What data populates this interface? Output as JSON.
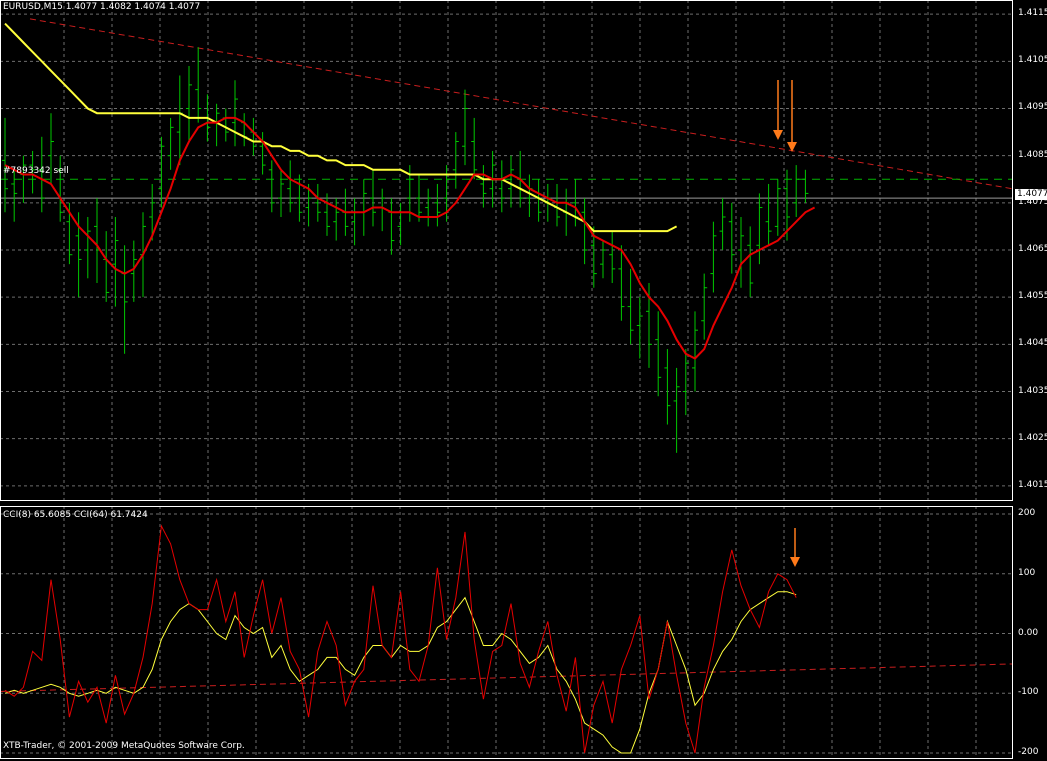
{
  "colors": {
    "background": "#000000",
    "grid": "#c8c8c8",
    "bars": "#00c800",
    "ma_fast": "#e60000",
    "ma_slow": "#ffff3c",
    "trendline": "#c81e1e",
    "order_line": "#00b400",
    "arrow": "#ff7a1a",
    "cci_fast": "#e60000",
    "cci_slow": "#ffff3c",
    "text": "#ffffff"
  },
  "price_panel": {
    "header": "EURUSD,M15  1.4077 1.4082 1.4074 1.4077",
    "order_label": "#7893342 sell",
    "current_price": "1.4077",
    "price_labels": [
      "1.4115",
      "1.4105",
      "1.4095",
      "1.4085",
      "1.4075",
      "1.4065",
      "1.4055",
      "1.4045",
      "1.4035",
      "1.4025",
      "1.4015"
    ],
    "ylim": [
      1.4012,
      1.4118
    ],
    "bars": [
      [
        1.4093,
        1.4073,
        1.4084,
        1.4078
      ],
      [
        1.4082,
        1.4071,
        1.4079,
        1.4077
      ],
      [
        1.4085,
        1.4075,
        1.4081,
        1.4083
      ],
      [
        1.4086,
        1.4077,
        1.4083,
        1.4082
      ],
      [
        1.4089,
        1.4073,
        1.4082,
        1.4076
      ],
      [
        1.4094,
        1.4079,
        1.4085,
        1.4088
      ],
      [
        1.4085,
        1.4071,
        1.4082,
        1.4073
      ],
      [
        1.4075,
        1.4062,
        1.4071,
        1.4064
      ],
      [
        1.4073,
        1.4055,
        1.4068,
        1.4063
      ],
      [
        1.4072,
        1.4059,
        1.4065,
        1.4069
      ],
      [
        1.4076,
        1.4058,
        1.407,
        1.4065
      ],
      [
        1.4069,
        1.4054,
        1.4063,
        1.4056
      ],
      [
        1.4072,
        1.4053,
        1.4062,
        1.4067
      ],
      [
        1.4066,
        1.4043,
        1.406,
        1.4054
      ],
      [
        1.4067,
        1.4054,
        1.406,
        1.4063
      ],
      [
        1.4073,
        1.4055,
        1.4064,
        1.407
      ],
      [
        1.4079,
        1.4067,
        1.4072,
        1.4075
      ],
      [
        1.4089,
        1.4074,
        1.4078,
        1.4087
      ],
      [
        1.4093,
        1.4082,
        1.4085,
        1.4091
      ],
      [
        1.4102,
        1.4083,
        1.409,
        1.4094
      ],
      [
        1.4104,
        1.4088,
        1.4095,
        1.41
      ],
      [
        1.4108,
        1.4092,
        1.4099,
        1.4095
      ],
      [
        1.4098,
        1.4088,
        1.4093,
        1.4091
      ],
      [
        1.4096,
        1.4087,
        1.4092,
        1.4094
      ],
      [
        1.4095,
        1.4088,
        1.4093,
        1.409
      ],
      [
        1.4101,
        1.4087,
        1.4092,
        1.4097
      ],
      [
        1.4094,
        1.4087,
        1.4092,
        1.4089
      ],
      [
        1.4093,
        1.4085,
        1.409,
        1.4087
      ],
      [
        1.409,
        1.4081,
        1.4087,
        1.4083
      ],
      [
        1.4084,
        1.4073,
        1.4082,
        1.4075
      ],
      [
        1.4082,
        1.4072,
        1.4076,
        1.4079
      ],
      [
        1.4084,
        1.4073,
        1.4078,
        1.4075
      ],
      [
        1.4081,
        1.4071,
        1.4076,
        1.4073
      ],
      [
        1.4079,
        1.407,
        1.4074,
        1.4076
      ],
      [
        1.4079,
        1.4071,
        1.4075,
        1.4073
      ],
      [
        1.4077,
        1.4068,
        1.4073,
        1.407
      ],
      [
        1.4076,
        1.4067,
        1.4071,
        1.4073
      ],
      [
        1.4078,
        1.4068,
        1.4073,
        1.407
      ],
      [
        1.4076,
        1.4066,
        1.4071,
        1.4073
      ],
      [
        1.408,
        1.4068,
        1.4073,
        1.4077
      ],
      [
        1.4082,
        1.407,
        1.4076,
        1.4073
      ],
      [
        1.4078,
        1.4069,
        1.4074,
        1.4076
      ],
      [
        1.4076,
        1.4064,
        1.4073,
        1.4067
      ],
      [
        1.4075,
        1.4066,
        1.407,
        1.4073
      ],
      [
        1.4083,
        1.4071,
        1.4076,
        1.408
      ],
      [
        1.4081,
        1.4071,
        1.4076,
        1.4073
      ],
      [
        1.4078,
        1.407,
        1.4074,
        1.4076
      ],
      [
        1.4079,
        1.407,
        1.4075,
        1.4073
      ],
      [
        1.4083,
        1.4071,
        1.4076,
        1.408
      ],
      [
        1.409,
        1.4078,
        1.4082,
        1.4088
      ],
      [
        1.4099,
        1.4083,
        1.4087,
        1.4095
      ],
      [
        1.4093,
        1.408,
        1.4088,
        1.4082
      ],
      [
        1.4083,
        1.4074,
        1.4079,
        1.4077
      ],
      [
        1.4086,
        1.4074,
        1.4078,
        1.4083
      ],
      [
        1.4084,
        1.4073,
        1.4078,
        1.4076
      ],
      [
        1.4085,
        1.4074,
        1.4078,
        1.4082
      ],
      [
        1.4086,
        1.4074,
        1.408,
        1.4076
      ],
      [
        1.4081,
        1.4072,
        1.4076,
        1.4078
      ],
      [
        1.408,
        1.4071,
        1.4076,
        1.4073
      ],
      [
        1.4079,
        1.4071,
        1.4075,
        1.4076
      ],
      [
        1.4079,
        1.407,
        1.4074,
        1.4072
      ],
      [
        1.4078,
        1.4068,
        1.4073,
        1.4075
      ],
      [
        1.408,
        1.407,
        1.4075,
        1.4072
      ],
      [
        1.4076,
        1.4062,
        1.4073,
        1.4065
      ],
      [
        1.407,
        1.4057,
        1.4066,
        1.406
      ],
      [
        1.4067,
        1.4059,
        1.4062,
        1.4065
      ],
      [
        1.4069,
        1.4058,
        1.4064,
        1.4061
      ],
      [
        1.4066,
        1.405,
        1.4061,
        1.4053
      ],
      [
        1.4061,
        1.4045,
        1.4053,
        1.4048
      ],
      [
        1.4055,
        1.4042,
        1.4049,
        1.4051
      ],
      [
        1.4058,
        1.404,
        1.4052,
        1.4045
      ],
      [
        1.4052,
        1.4034,
        1.4046,
        1.4038
      ],
      [
        1.4044,
        1.4028,
        1.404,
        1.4032
      ],
      [
        1.404,
        1.4022,
        1.4033,
        1.4036
      ],
      [
        1.4044,
        1.403,
        1.4035,
        1.4041
      ],
      [
        1.4052,
        1.4035,
        1.404,
        1.4048
      ],
      [
        1.406,
        1.4046,
        1.405,
        1.4057
      ],
      [
        1.4071,
        1.4056,
        1.406,
        1.4068
      ],
      [
        1.4076,
        1.4065,
        1.4069,
        1.4072
      ],
      [
        1.4075,
        1.406,
        1.4071,
        1.4064
      ],
      [
        1.4072,
        1.4057,
        1.4065,
        1.4068
      ],
      [
        1.407,
        1.4055,
        1.4066,
        1.4058
      ],
      [
        1.4077,
        1.4062,
        1.4066,
        1.4074
      ],
      [
        1.4079,
        1.4066,
        1.4071,
        1.4069
      ],
      [
        1.408,
        1.4068,
        1.407,
        1.4078
      ],
      [
        1.4082,
        1.4067,
        1.4078,
        1.4072
      ],
      [
        1.4083,
        1.4072,
        1.4075,
        1.408
      ],
      [
        1.4082,
        1.4075,
        1.408,
        1.4077
      ]
    ],
    "ma_fast": [
      1.4083,
      1.4082,
      1.4081,
      1.4081,
      1.408,
      1.4079,
      1.4076,
      1.4073,
      1.407,
      1.4068,
      1.4066,
      1.4063,
      1.4061,
      1.406,
      1.4061,
      1.4064,
      1.4068,
      1.4073,
      1.4078,
      1.4084,
      1.4088,
      1.4091,
      1.4092,
      1.4092,
      1.4093,
      1.4093,
      1.4092,
      1.409,
      1.4088,
      1.4085,
      1.4082,
      1.408,
      1.4079,
      1.4078,
      1.4076,
      1.4075,
      1.4074,
      1.4073,
      1.4073,
      1.4073,
      1.4074,
      1.4074,
      1.4073,
      1.4073,
      1.4073,
      1.4072,
      1.4072,
      1.4072,
      1.4073,
      1.4075,
      1.4078,
      1.4081,
      1.4081,
      1.408,
      1.408,
      1.4081,
      1.408,
      1.4078,
      1.4077,
      1.4076,
      1.4075,
      1.4075,
      1.4074,
      1.4071,
      1.4068,
      1.4067,
      1.4066,
      1.4065,
      1.4062,
      1.4058,
      1.4055,
      1.4053,
      1.405,
      1.4046,
      1.4043,
      1.4042,
      1.4044,
      1.4049,
      1.4053,
      1.4057,
      1.4062,
      1.4064,
      1.4065,
      1.4066,
      1.4067,
      1.4069,
      1.4071,
      1.4073,
      1.4074
    ],
    "ma_slow": [
      1.4113,
      1.4111,
      1.4109,
      1.4107,
      1.4105,
      1.4103,
      1.4101,
      1.4099,
      1.4097,
      1.4095,
      1.4094,
      1.4094,
      1.4094,
      1.4094,
      1.4094,
      1.4094,
      1.4094,
      1.4094,
      1.4094,
      1.4094,
      1.4093,
      1.4093,
      1.4093,
      1.4092,
      1.4091,
      1.409,
      1.4089,
      1.4088,
      1.4088,
      1.4087,
      1.4087,
      1.4086,
      1.4086,
      1.4085,
      1.4085,
      1.4084,
      1.4084,
      1.4083,
      1.4083,
      1.4083,
      1.4082,
      1.4082,
      1.4082,
      1.4082,
      1.4081,
      1.4081,
      1.4081,
      1.4081,
      1.4081,
      1.4081,
      1.4081,
      1.4081,
      1.408,
      1.408,
      1.408,
      1.4079,
      1.4078,
      1.4077,
      1.4076,
      1.4075,
      1.4074,
      1.4073,
      1.4072,
      1.4071,
      1.4069,
      1.4069,
      1.4069,
      1.4069,
      1.4069,
      1.4069,
      1.4069,
      1.4069,
      1.4069,
      1.407
    ],
    "trendline": {
      "from": [
        0,
        1.4114
      ],
      "to": [
        100,
        1.4078
      ]
    },
    "order_price": 1.408
  },
  "cci_panel": {
    "header": "CCI(8) 65.6085  CCI(64) 61.7424",
    "ylim": [
      -200,
      200
    ],
    "level_labels": [
      "200",
      "100",
      "0.00",
      "-100",
      "-200"
    ],
    "levels": [
      200,
      100,
      0,
      -100,
      -200
    ],
    "cci_fast": [
      -95,
      -105,
      -90,
      -30,
      -45,
      90,
      -10,
      -140,
      -80,
      -115,
      -90,
      -150,
      -70,
      -135,
      -100,
      -40,
      50,
      180,
      150,
      90,
      50,
      40,
      40,
      90,
      20,
      70,
      -40,
      30,
      90,
      0,
      60,
      -30,
      -60,
      -140,
      -30,
      20,
      -20,
      -120,
      -80,
      -60,
      80,
      -20,
      -40,
      70,
      -60,
      -80,
      -20,
      110,
      -10,
      60,
      170,
      -10,
      -110,
      -30,
      -20,
      50,
      -50,
      -90,
      -30,
      20,
      -70,
      -130,
      -40,
      -200,
      -120,
      -80,
      -150,
      -60,
      -20,
      30,
      -110,
      -60,
      20,
      -70,
      -150,
      -200,
      -90,
      -20,
      70,
      140,
      80,
      40,
      10,
      70,
      100,
      90,
      60
    ],
    "cci_slow": [
      -100,
      -95,
      -100,
      -95,
      -90,
      -85,
      -90,
      -100,
      -105,
      -100,
      -95,
      -100,
      -90,
      -95,
      -100,
      -90,
      -60,
      -10,
      20,
      40,
      50,
      40,
      20,
      0,
      -10,
      30,
      10,
      0,
      10,
      -40,
      -20,
      -60,
      -80,
      -70,
      -60,
      -40,
      -40,
      -60,
      -70,
      -40,
      -20,
      -20,
      -40,
      -20,
      -30,
      -30,
      -20,
      10,
      20,
      40,
      60,
      20,
      -20,
      -20,
      0,
      -10,
      -30,
      -50,
      -40,
      -20,
      -60,
      -80,
      -110,
      -150,
      -160,
      -170,
      -190,
      -200,
      -200,
      -160,
      -100,
      -60,
      20,
      -20,
      -60,
      -120,
      -100,
      -60,
      -30,
      -10,
      20,
      40,
      50,
      60,
      70,
      70,
      65
    ],
    "trendline": {
      "from": [
        0,
        -97
      ],
      "to": [
        100,
        -51
      ]
    }
  },
  "copyright": "XTB-Trader, © 2001-2009 MetaQuotes Software Corp."
}
